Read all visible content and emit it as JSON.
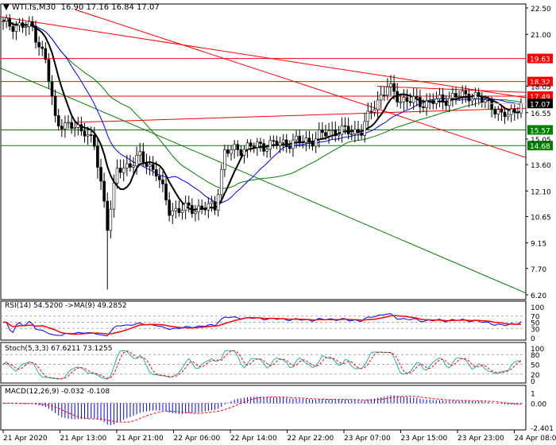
{
  "header": {
    "symbol": "WTI.fs,M30",
    "ohlc": "16.90 17.16 16.84 17.07"
  },
  "chart_data": [
    {
      "type": "candlestick",
      "title": "WTI.fs,M30 16.90 17.16 16.84 17.07",
      "ylim": [
        6.2,
        22.5
      ],
      "y_ticks": [
        "22.50",
        "21.00",
        "18.05",
        "16.55",
        "15.05",
        "13.60",
        "12.10",
        "10.65",
        "9.15",
        "7.70",
        "6.20"
      ],
      "y_tick_values": [
        22.5,
        21.0,
        18.05,
        16.55,
        15.05,
        13.6,
        12.1,
        10.65,
        9.15,
        7.7,
        6.2
      ],
      "close_keypoints": [
        [
          0,
          21.6
        ],
        [
          9,
          21.4
        ],
        [
          13,
          19.5
        ],
        [
          16,
          16.2
        ],
        [
          19,
          15.8
        ],
        [
          25,
          15.6
        ],
        [
          28,
          14.6
        ],
        [
          31,
          11.5
        ],
        [
          32,
          10.2
        ],
        [
          35,
          13.2
        ],
        [
          42,
          14.0
        ],
        [
          47,
          13.2
        ],
        [
          51,
          11.0
        ],
        [
          58,
          11.1
        ],
        [
          65,
          11.2
        ],
        [
          68,
          14.3
        ],
        [
          75,
          14.6
        ],
        [
          85,
          14.8
        ],
        [
          95,
          15.0
        ],
        [
          100,
          15.5
        ],
        [
          110,
          15.5
        ],
        [
          114,
          17.0
        ],
        [
          118,
          18.0
        ],
        [
          122,
          17.3
        ],
        [
          130,
          17.1
        ],
        [
          140,
          17.5
        ],
        [
          143,
          17.6
        ],
        [
          150,
          17.0
        ],
        [
          153,
          16.3
        ],
        [
          157,
          16.7
        ],
        [
          159,
          17.07
        ]
      ],
      "levels": [
        {
          "price": 19.63,
          "label": "19.63",
          "color": "#ff0000"
        },
        {
          "price": 18.32,
          "label": "18.32",
          "color": "#ff0000"
        },
        {
          "price": 17.49,
          "label": "17.49",
          "color": "#ff0000"
        },
        {
          "price": 15.57,
          "label": "15.57",
          "color": "#008000"
        },
        {
          "price": 14.68,
          "label": "14.68",
          "color": "#008000"
        }
      ],
      "current_price": {
        "price": 17.07,
        "label": "17.07"
      }
    },
    {
      "type": "line",
      "title": "RSI(14) 54.5200  ->MA(9) 49.2852",
      "y_ticks": [
        "100",
        "70",
        "50",
        "30",
        "0"
      ],
      "levels": [
        70,
        50,
        30
      ]
    },
    {
      "type": "line",
      "title": "Stoch(5,3,3) 67.6211 73.1255",
      "y_ticks": [
        "100",
        "80",
        "50",
        "20",
        "0"
      ],
      "levels": [
        80,
        50,
        20
      ]
    },
    {
      "type": "bar",
      "title": "MACD(12,26,9) -0.032 -0.108",
      "y_ticks": [
        "1",
        "0.00",
        "-2.401"
      ]
    }
  ],
  "x_ticks": [
    "21 Apr 2020",
    "21 Apr 13:00",
    "21 Apr 21:00",
    "22 Apr 06:00",
    "22 Apr 14:00",
    "22 Apr 22:00",
    "23 Apr 07:00",
    "23 Apr 15:00",
    "23 Apr 23:00",
    "24 Apr 08:00"
  ],
  "colors": {
    "bull": "#000000",
    "ma_fast": "#000000",
    "ma_mid": "#0000ff",
    "ma_slow": "#008000",
    "trend": "#ff0000"
  }
}
